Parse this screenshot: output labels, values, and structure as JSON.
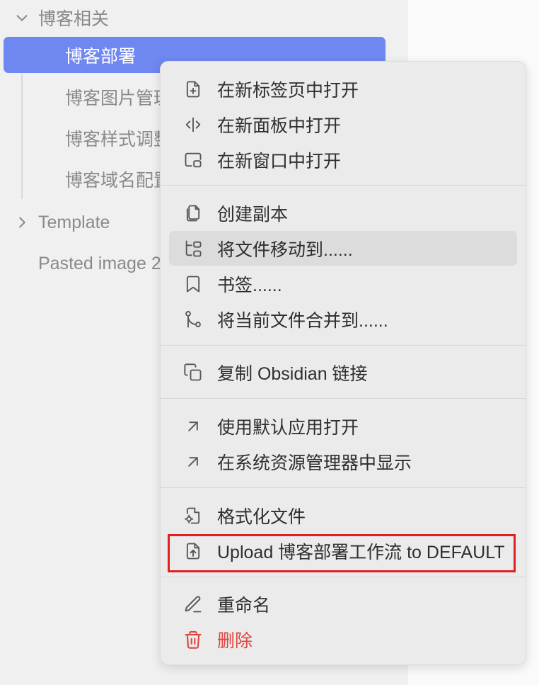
{
  "sidebar": {
    "folder_blog": {
      "label": "博客相关",
      "icon": "chevron-down-icon"
    },
    "active_file": {
      "label": "博客部署"
    },
    "files": [
      {
        "label": "博客图片管理"
      },
      {
        "label": "博客样式调整"
      },
      {
        "label": "博客域名配置"
      }
    ],
    "folder_template": {
      "label": "Template",
      "icon": "chevron-right-icon"
    },
    "pasted_image": {
      "label": "Pasted image 2"
    }
  },
  "context_menu": {
    "items": [
      {
        "label": "在新标签页中打开",
        "icon": "file-plus-icon"
      },
      {
        "label": "在新面板中打开",
        "icon": "split-vertical-icon"
      },
      {
        "label": "在新窗口中打开",
        "icon": "new-window-icon"
      },
      {
        "label": "创建副本",
        "icon": "files-copy-icon"
      },
      {
        "label": "将文件移动到......",
        "icon": "folder-tree-icon"
      },
      {
        "label": "书签......",
        "icon": "bookmark-icon"
      },
      {
        "label": "将当前文件合并到......",
        "icon": "git-merge-icon"
      },
      {
        "label": "复制 Obsidian 链接",
        "icon": "copy-link-icon"
      },
      {
        "label": "使用默认应用打开",
        "icon": "arrow-up-right-icon"
      },
      {
        "label": "在系统资源管理器中显示",
        "icon": "arrow-up-right-icon"
      },
      {
        "label": "格式化文件",
        "icon": "file-cog-icon"
      },
      {
        "label": "Upload 博客部署工作流 to DEFAULT",
        "icon": "file-upload-icon"
      },
      {
        "label": "重命名",
        "icon": "pencil-icon"
      },
      {
        "label": "删除",
        "icon": "trash-icon"
      }
    ]
  },
  "colors": {
    "accent": "#6f87f0",
    "danger": "#e0443e",
    "highlight_border": "#e02020"
  }
}
